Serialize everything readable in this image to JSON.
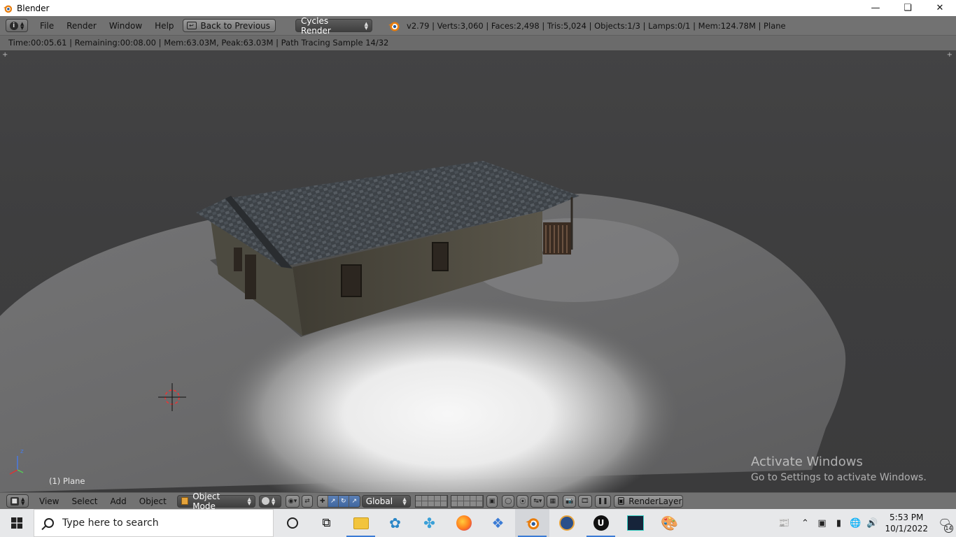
{
  "window": {
    "title": "Blender",
    "minimize_icon": "minimize-icon",
    "maximize_icon": "restore-icon",
    "close_icon": "close-icon"
  },
  "info_header": {
    "menus": [
      "File",
      "Render",
      "Window",
      "Help"
    ],
    "back_button": "Back to Previous",
    "render_engine": "Cycles Render",
    "stats": "v2.79 | Verts:3,060 | Faces:2,498 | Tris:5,024 | Objects:1/3 | Lamps:0/1 | Mem:124.78M | Plane"
  },
  "render_status": "Time:00:05.61 | Remaining:00:08.00 | Mem:63.03M, Peak:63.03M | Path Tracing Sample 14/32",
  "viewport": {
    "object_label": "(1) Plane",
    "axis_label": "z",
    "watermark_title": "Activate Windows",
    "watermark_sub": "Go to Settings to activate Windows."
  },
  "view_header": {
    "menus": [
      "View",
      "Select",
      "Add",
      "Object"
    ],
    "mode": "Object Mode",
    "orientation": "Global",
    "render_layer": "RenderLayer"
  },
  "taskbar": {
    "search_placeholder": "Type here to search",
    "time": "5:53 PM",
    "date": "10/1/2022",
    "notification_count": "14",
    "apps": [
      "task-view-icon",
      "cortana-icon",
      "file-explorer-icon",
      "dolphin-icon",
      "network-app-icon",
      "firefox-icon",
      "sketch-app-icon",
      "blender-icon",
      "media-app-icon",
      "unreal-engine-icon",
      "game-launcher-icon",
      "paint-icon"
    ]
  },
  "colors": {
    "blender_header": "#727272",
    "viewport_bg": "#3e3e3f",
    "select_dark": "#4a4a4a",
    "active_blue": "#4a72ad",
    "taskbar": "#e7e8ea"
  }
}
